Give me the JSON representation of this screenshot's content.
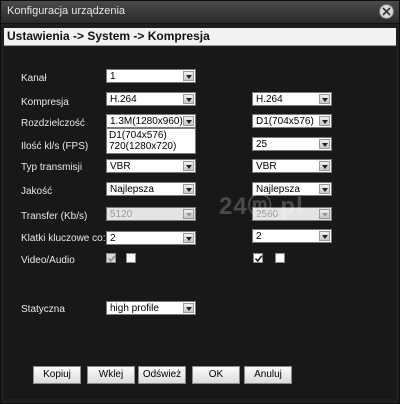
{
  "window": {
    "title": "Konfiguracja urządzenia"
  },
  "header": {
    "breadcrumb": "Ustawienia -> System -> Kompresja"
  },
  "watermark": "24ⓜ.pl",
  "rows": {
    "kanal": {
      "label": "Kanał",
      "left": "1"
    },
    "kompresja": {
      "label": "Kompresja",
      "left": "H.264",
      "right": "H.264"
    },
    "rozdzielczosc": {
      "label": "Rozdzielczość",
      "left": "1.3M(1280x960)",
      "right": "D1(704x576)"
    },
    "fps": {
      "label": "Ilość kl/s (FPS)",
      "right": "25",
      "options": [
        "D1(704x576)",
        "720(1280x720)"
      ]
    },
    "typ": {
      "label": "Typ transmisji",
      "left": "VBR",
      "right": "VBR"
    },
    "jakosc": {
      "label": "Jakość",
      "left": "Najlepsza",
      "right": "Najlepsza"
    },
    "transfer": {
      "label": "Transfer (Kb/s)",
      "left": "5120",
      "right": "2560"
    },
    "klatki": {
      "label": "Klatki kluczowe co:",
      "left": "2",
      "right": "2"
    },
    "videoaudio": {
      "label": "Video/Audio",
      "left_video": true,
      "left_audio": false,
      "right_video": true,
      "right_audio": false
    },
    "statyczna": {
      "label": "Statyczna",
      "value": "high profile"
    }
  },
  "buttons": {
    "kopiuj": "Kopiuj",
    "wklej": "Wklej",
    "odswiez": "Odśwież",
    "ok": "OK",
    "anuluj": "Anuluj"
  }
}
